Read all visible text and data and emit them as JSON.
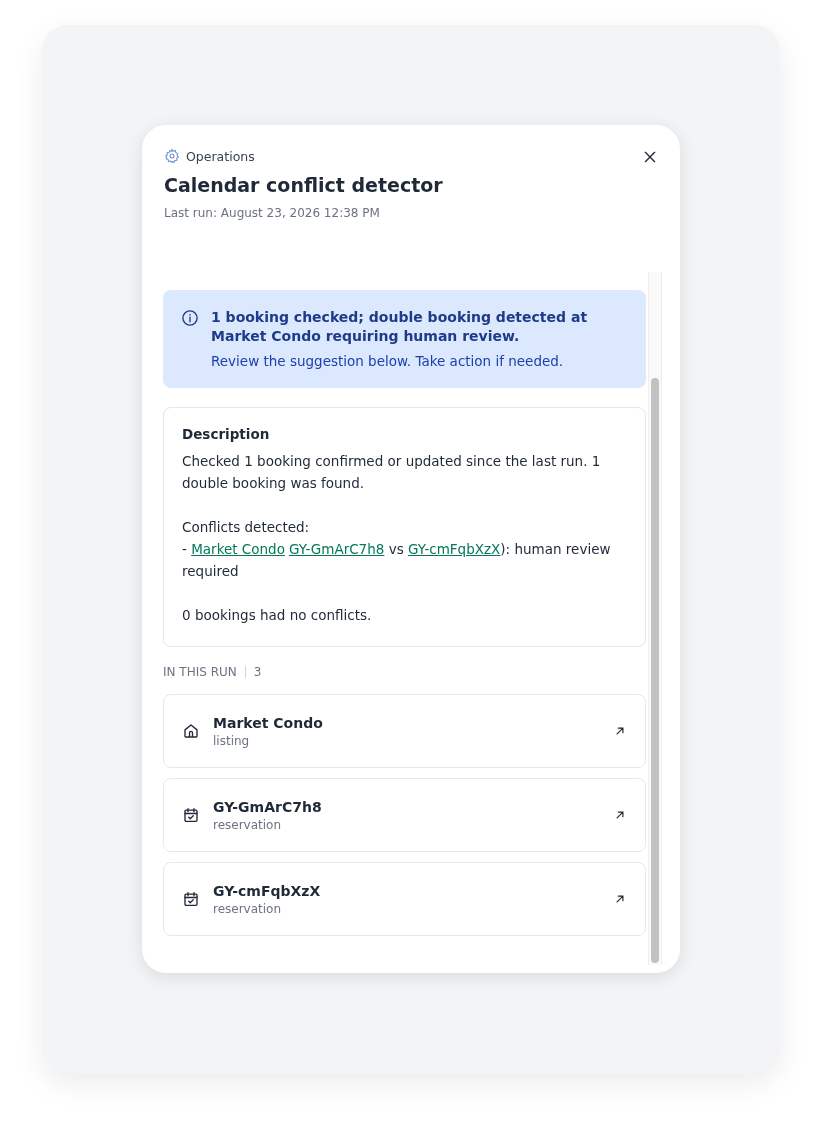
{
  "header": {
    "category": "Operations",
    "title": "Calendar conflict detector",
    "last_run": "Last run: August 23, 2026 12:38 PM"
  },
  "alert": {
    "title": "1 booking checked; double booking detected at Market Condo requiring human review.",
    "message": "Review the suggestion below. Take action if needed."
  },
  "description": {
    "heading": "Description",
    "summary": "Checked 1 booking confirmed or updated since the last run. 1 double booking was found.",
    "conflicts_heading": "Conflicts detected:",
    "conflict_line": [
      {
        "kind": "text",
        "text": "- "
      },
      {
        "kind": "link",
        "text": "Market Condo"
      },
      {
        "kind": "link",
        "text": "GY-GmArC7h8"
      },
      {
        "kind": "text",
        "text": " vs "
      },
      {
        "kind": "link",
        "text": "GY-cmFqbXzX"
      },
      {
        "kind": "text",
        "text": "): human review required"
      }
    ],
    "footer": "0 bookings had no conflicts."
  },
  "run_section": {
    "label": "IN THIS RUN",
    "count": "3"
  },
  "items": [
    {
      "kind": "listing",
      "title": "Market Condo",
      "subtitle": "listing"
    },
    {
      "kind": "reservation",
      "title": "GY-GmArC7h8",
      "subtitle": "reservation"
    },
    {
      "kind": "reservation",
      "title": "GY-cmFqbXzX",
      "subtitle": "reservation"
    }
  ]
}
